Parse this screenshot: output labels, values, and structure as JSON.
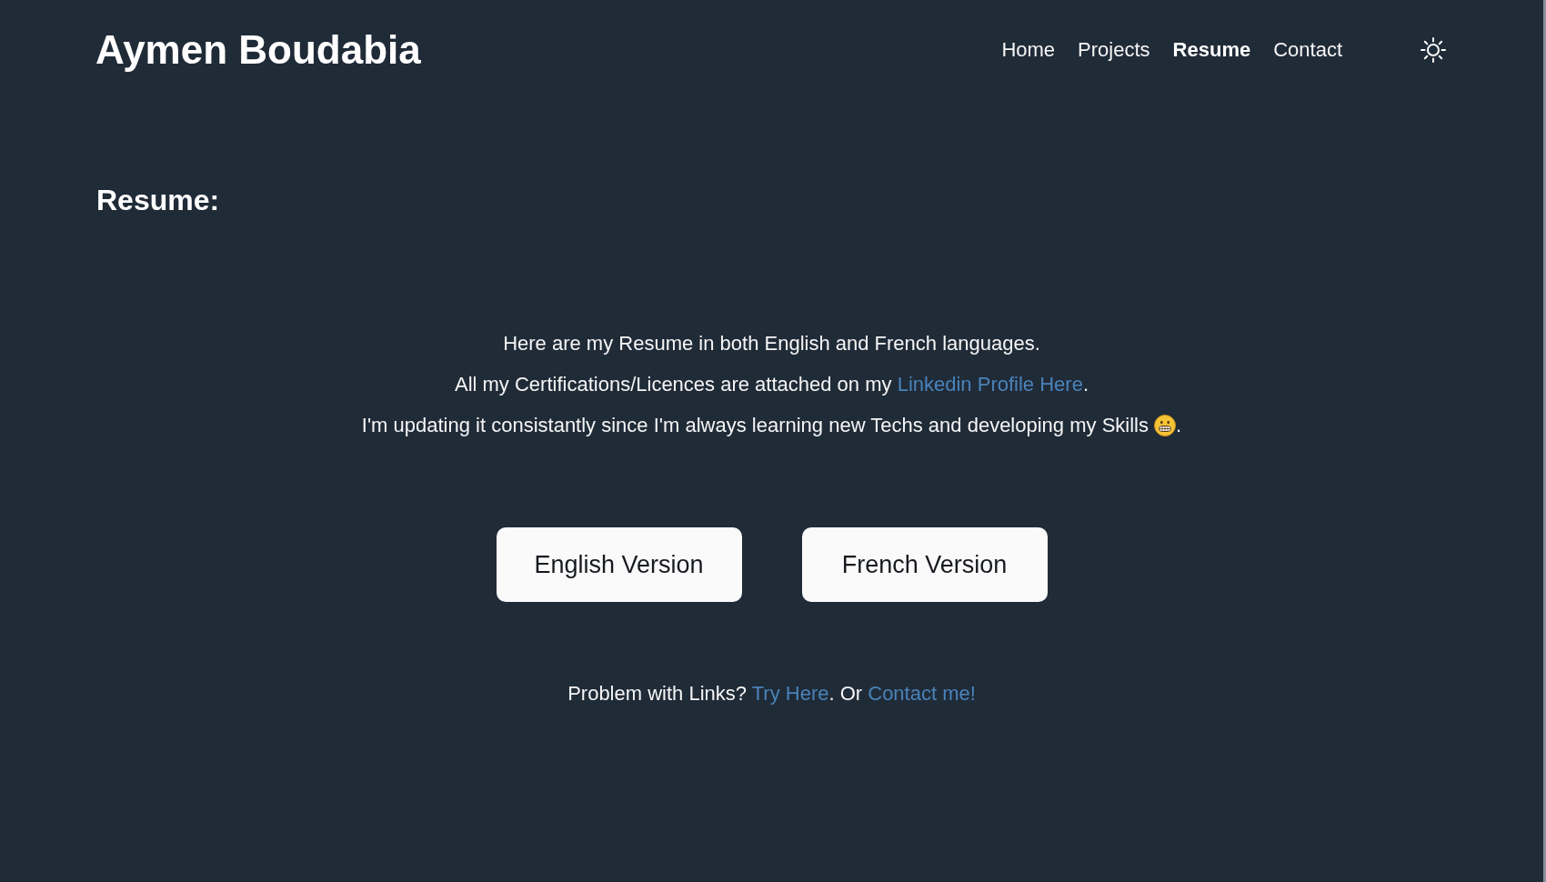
{
  "header": {
    "title": "Aymen Boudabia",
    "nav": [
      {
        "label": "Home",
        "selected": false
      },
      {
        "label": "Projects",
        "selected": false
      },
      {
        "label": "Resume",
        "selected": true
      },
      {
        "label": "Contact",
        "selected": false
      }
    ]
  },
  "section": {
    "heading": "Resume:"
  },
  "intro": {
    "lines": [
      [
        {
          "kind": "text",
          "text": "Here are my Resume in both English and French languages."
        }
      ],
      [
        {
          "kind": "text",
          "text": "All my Certifications/Licences are attached on my "
        },
        {
          "kind": "link",
          "text": "Linkedin Profile Here"
        },
        {
          "kind": "text",
          "text": "."
        }
      ],
      [
        {
          "kind": "text",
          "text": "I'm updating it consistantly since I'm always learning new Techs and developing my Skills "
        },
        {
          "kind": "emoji"
        },
        {
          "kind": "text",
          "text": "."
        }
      ]
    ]
  },
  "buttons": [
    "English Version",
    "French Version"
  ],
  "footer": {
    "segments": [
      {
        "kind": "text",
        "text": "Problem with Links? "
      },
      {
        "kind": "link",
        "text": "Try Here"
      },
      {
        "kind": "text",
        "text": ". Or "
      },
      {
        "kind": "link",
        "text": "Contact me!"
      }
    ]
  }
}
